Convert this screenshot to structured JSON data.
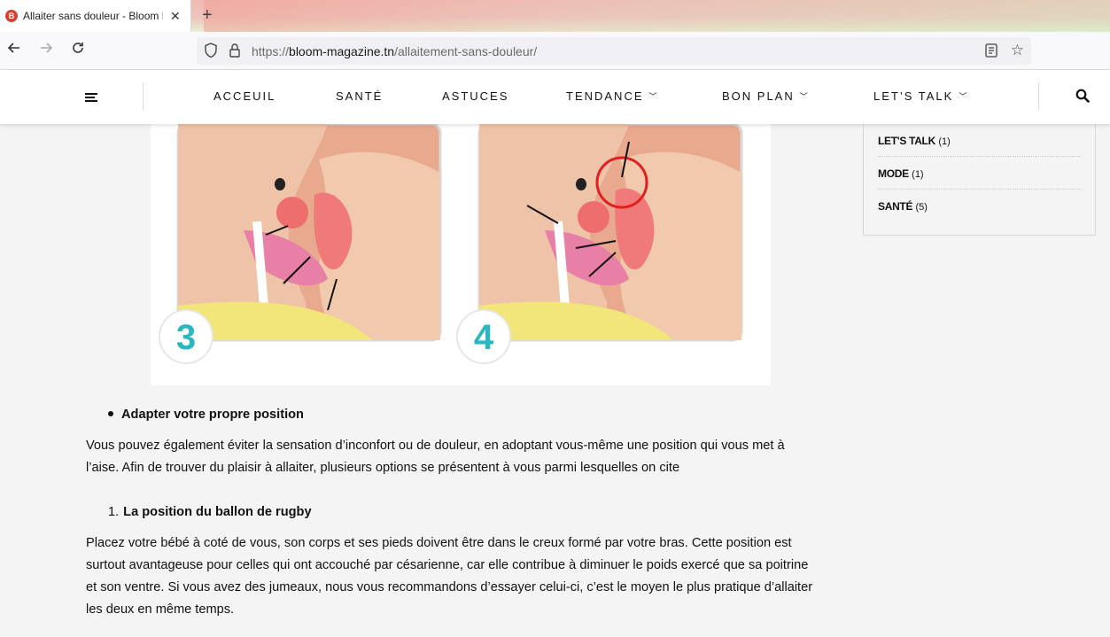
{
  "browser": {
    "tab_title": "Allaiter sans douleur - Bloom M",
    "favicon_letter": "B",
    "url_scheme": "https://",
    "url_host": "bloom-magazine.tn",
    "url_path": "/allaitement-sans-douleur/"
  },
  "nav": {
    "items": [
      {
        "label": "ACCEUIL",
        "has_dropdown": false
      },
      {
        "label": "SANTÉ",
        "has_dropdown": false
      },
      {
        "label": "ASTUCES",
        "has_dropdown": false
      },
      {
        "label": "TENDANCE",
        "has_dropdown": true
      },
      {
        "label": "BON PLAN",
        "has_dropdown": true
      },
      {
        "label": "LET’S TALK",
        "has_dropdown": true
      }
    ],
    "search_icon": "search-icon",
    "menu_icon": "hamburger-icon"
  },
  "figure": {
    "panel_numbers": [
      "3",
      "4"
    ],
    "accent_color": "#2bb7c1"
  },
  "sidebar": {
    "categories": [
      {
        "name": "LET'S TALK",
        "count": "(1)"
      },
      {
        "name": "MODE",
        "count": "(1)"
      },
      {
        "name": "SANTÉ",
        "count": "(5)"
      }
    ]
  },
  "article": {
    "bullet_heading": "Adapter votre propre position",
    "para1_line1": "Vous pouvez également éviter la sensation d’inconfort ou de douleur, en adoptant vous-même une position qui vous met à",
    "para1_line2": "l’aise. Afin de trouver du plaisir à allaiter, plusieurs options se présentent à vous parmi lesquelles on cite",
    "list_number": "1.",
    "list_heading": "La position du ballon de rugby",
    "para2_line1": "Placez votre bébé à coté de vous, son corps et ses pieds doivent être dans le creux formé par votre bras. Cette position est",
    "para2_line2": "surtout avantageuse pour  celles qui ont accouché par césarienne, car elle contribue à diminuer le poids exercé que sa poitrine",
    "para2_line3": "et son ventre. Si vous avez des jumeaux, nous vous recommandons d’essayer celui-ci, c’est le moyen le plus pratique d’allaiter",
    "para2_line4": "les deux en même temps."
  }
}
